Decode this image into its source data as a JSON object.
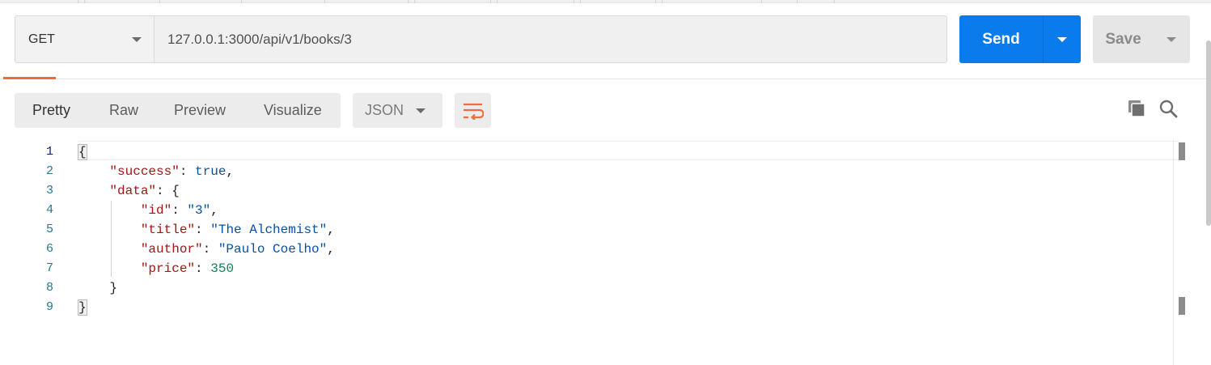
{
  "request": {
    "method": "GET",
    "url": "127.0.0.1:3000/api/v1/books/3",
    "send_label": "Send",
    "save_label": "Save"
  },
  "response": {
    "view_tabs": [
      "Pretty",
      "Raw",
      "Preview",
      "Visualize"
    ],
    "active_view": "Pretty",
    "format": "JSON",
    "icons": {
      "wrap": "wrap-lines-icon",
      "copy": "copy-icon",
      "search": "search-icon"
    },
    "line_numbers": [
      "1",
      "2",
      "3",
      "4",
      "5",
      "6",
      "7",
      "8",
      "9"
    ],
    "body": {
      "success_key": "\"success\"",
      "success_value": "true",
      "data_key": "\"data\"",
      "id_key": "\"id\"",
      "id_value": "\"3\"",
      "title_key": "\"title\"",
      "title_value": "\"The Alchemist\"",
      "author_key": "\"author\"",
      "author_value": "\"Paulo Coelho\"",
      "price_key": "\"price\"",
      "price_value": "350"
    }
  },
  "colors": {
    "send": "#097bed",
    "accent": "#f26b3a",
    "json_key": "#a31515",
    "json_string": "#0451a5",
    "json_number": "#098658"
  }
}
